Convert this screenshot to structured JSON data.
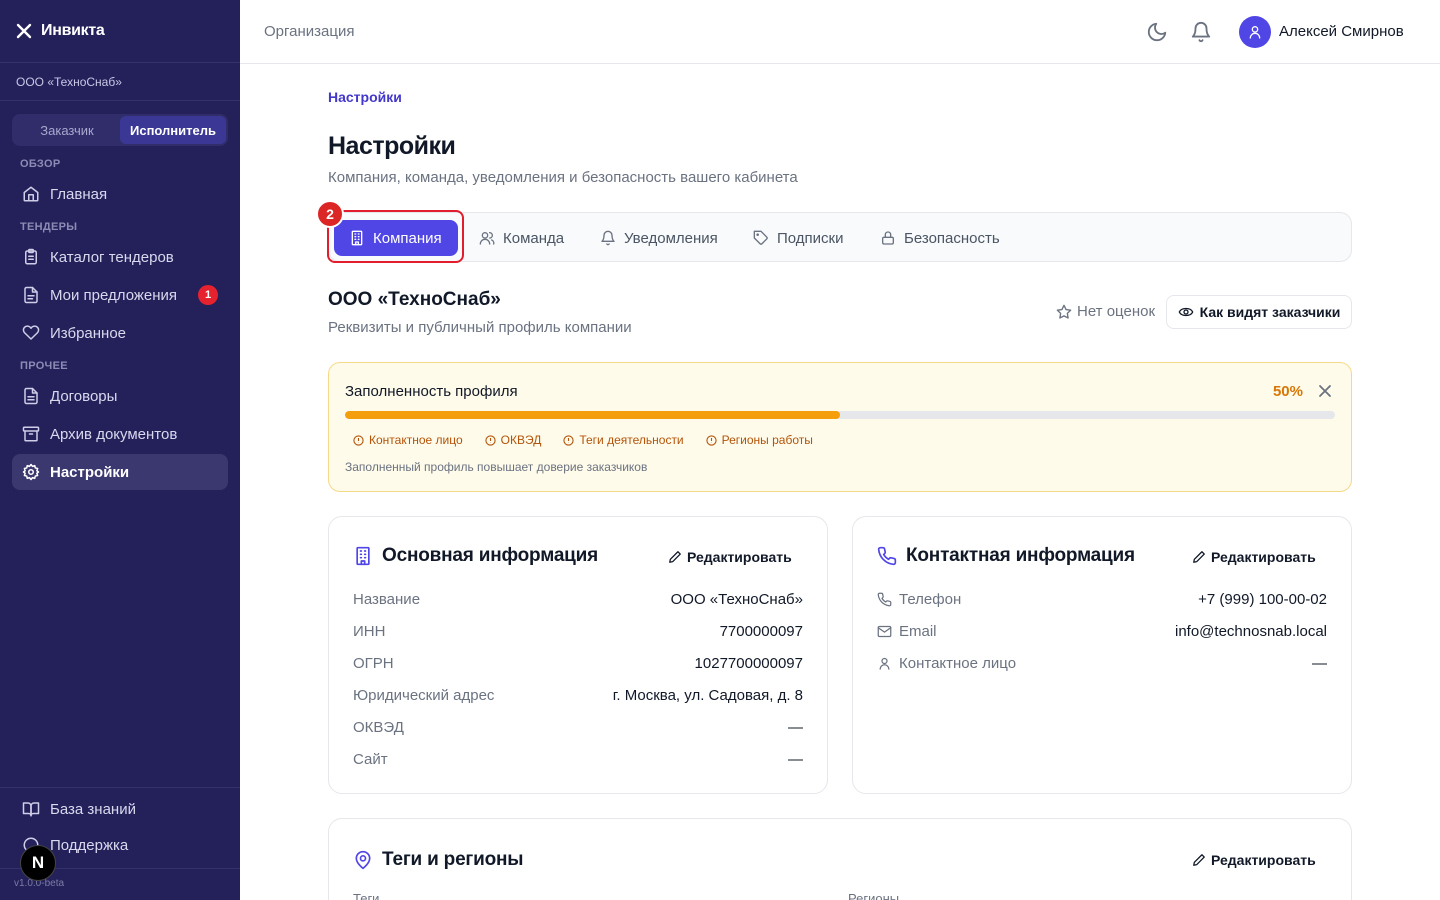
{
  "brand": {
    "name": "Инвикта"
  },
  "sidebar": {
    "org": "ООО «ТехноСнаб»",
    "roles": {
      "customer": "Заказчик",
      "contractor": "Исполнитель"
    },
    "sections": {
      "overview": "ОБЗОР",
      "tenders": "ТЕНДЕРЫ",
      "other": "ПРОЧЕЕ"
    },
    "items": {
      "home": "Главная",
      "catalog": "Каталог тендеров",
      "offers": "Мои предложения",
      "offers_badge": "1",
      "favorites": "Избранное",
      "contracts": "Договоры",
      "archive": "Архив документов",
      "settings": "Настройки",
      "kb": "База знаний",
      "support": "Поддержка"
    },
    "version": "v1.0.0-beta",
    "next_badge": "N"
  },
  "topbar": {
    "title": "Организация",
    "user": "Алексей Смирнов"
  },
  "page": {
    "breadcrumb": "Настройки",
    "title": "Настройки",
    "subtitle": "Компания, команда, уведомления и безопасность вашего кабинета"
  },
  "tabs": {
    "company": "Компания",
    "team": "Команда",
    "notifications": "Уведомления",
    "subscriptions": "Подписки",
    "security": "Безопасность",
    "step": "2"
  },
  "company": {
    "name": "ООО «ТехноСнаб»",
    "subtitle": "Реквизиты и публичный профиль компании",
    "rating": "Нет оценок",
    "view_button": "Как видят заказчики"
  },
  "profile_progress": {
    "title": "Заполненность профиля",
    "percent_label": "50%",
    "percent": 50,
    "missing": [
      "Контактное лицо",
      "ОКВЭД",
      "Теги деятельности",
      "Регионы работы"
    ],
    "note": "Заполненный профиль повышает доверие заказчиков"
  },
  "basic_info": {
    "title": "Основная информация",
    "edit": "Редактировать",
    "rows": [
      {
        "label": "Название",
        "value": "ООО «ТехноСнаб»"
      },
      {
        "label": "ИНН",
        "value": "7700000097"
      },
      {
        "label": "ОГРН",
        "value": "1027700000097"
      },
      {
        "label": "Юридический адрес",
        "value": "г. Москва, ул. Садовая, д. 8"
      },
      {
        "label": "ОКВЭД",
        "value": "—"
      },
      {
        "label": "Сайт",
        "value": "—"
      }
    ]
  },
  "contact_info": {
    "title": "Контактная информация",
    "edit": "Редактировать",
    "rows": [
      {
        "label": "Телефон",
        "value": "+7 (999) 100-00-02"
      },
      {
        "label": "Email",
        "value": "info@technosnab.local"
      },
      {
        "label": "Контактное лицо",
        "value": "—"
      }
    ]
  },
  "tags_regions": {
    "title": "Теги и регионы",
    "edit": "Редактировать",
    "tags_label": "Теги",
    "regions_label": "Регионы"
  },
  "colors": {
    "accent": "#4f46e5",
    "sidebar": "#24215a",
    "warning": "#f59e0b",
    "danger": "#e11d2e"
  }
}
